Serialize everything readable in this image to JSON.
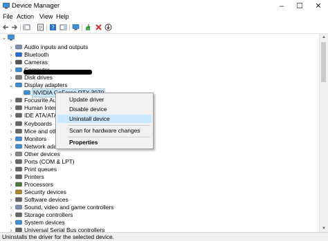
{
  "window": {
    "title": "Device Manager"
  },
  "menu": [
    "File",
    "Action",
    "View",
    "Help"
  ],
  "tree": [
    {
      "label": "Audio inputs and outputs",
      "icon": "speaker-icon",
      "color": "#7f8fa6"
    },
    {
      "label": "Bluetooth",
      "icon": "bluetooth-icon",
      "color": "#1f6fd1"
    },
    {
      "label": "Cameras",
      "icon": "camera-icon",
      "color": "#555555"
    },
    {
      "label": "Computer",
      "icon": "computer-icon",
      "color": "#3b8fd6"
    },
    {
      "label": "Disk drives",
      "icon": "disk-drive-icon",
      "color": "#777777"
    },
    {
      "label": "Display adapters",
      "icon": "display-adapter-icon",
      "color": "#3b8fd6",
      "expanded": true
    },
    {
      "label": "NVIDIA GeForce RTX 3070",
      "icon": "display-adapter-icon",
      "color": "#3b8fd6",
      "child": true,
      "selected": true
    },
    {
      "label": "Focusrite Au",
      "icon": "usb-icon",
      "color": "#666666"
    },
    {
      "label": "Human Inter",
      "icon": "hid-icon",
      "color": "#666666"
    },
    {
      "label": "IDE ATA/ATAP",
      "icon": "ide-icon",
      "color": "#666666"
    },
    {
      "label": "Keyboards",
      "icon": "keyboard-icon",
      "color": "#666666"
    },
    {
      "label": "Mice and oth",
      "icon": "mouse-icon",
      "color": "#666666"
    },
    {
      "label": "Monitors",
      "icon": "monitor-icon",
      "color": "#3b8fd6"
    },
    {
      "label": "Network ada",
      "icon": "network-adapter-icon",
      "color": "#3b8fd6"
    },
    {
      "label": "Other devices",
      "icon": "other-device-icon",
      "color": "#888888"
    },
    {
      "label": "Ports (COM & LPT)",
      "icon": "port-icon",
      "color": "#666666"
    },
    {
      "label": "Print queues",
      "icon": "printer-icon",
      "color": "#666666"
    },
    {
      "label": "Printers",
      "icon": "printer-icon",
      "color": "#666666"
    },
    {
      "label": "Processors",
      "icon": "processor-icon",
      "color": "#4a7a3a"
    },
    {
      "label": "Security devices",
      "icon": "security-device-icon",
      "color": "#b08a2a"
    },
    {
      "label": "Software devices",
      "icon": "software-device-icon",
      "color": "#666666"
    },
    {
      "label": "Sound, video and game controllers",
      "icon": "sound-icon",
      "color": "#7f8fa6"
    },
    {
      "label": "Storage controllers",
      "icon": "storage-controller-icon",
      "color": "#666666"
    },
    {
      "label": "System devices",
      "icon": "system-device-icon",
      "color": "#3b8fd6"
    },
    {
      "label": "Universal Serial Bus controllers",
      "icon": "usb-icon",
      "color": "#666666"
    }
  ],
  "context_menu": {
    "items": [
      "Update driver",
      "Disable device",
      "Uninstall device",
      "Scan for hardware changes",
      "Properties"
    ],
    "highlighted": "Uninstall device"
  },
  "status": "Uninstalls the driver for the selected device.",
  "colors": {
    "highlight": "#cce8ff",
    "selection": "#cce8ff",
    "accent": "#1f6fd1"
  }
}
